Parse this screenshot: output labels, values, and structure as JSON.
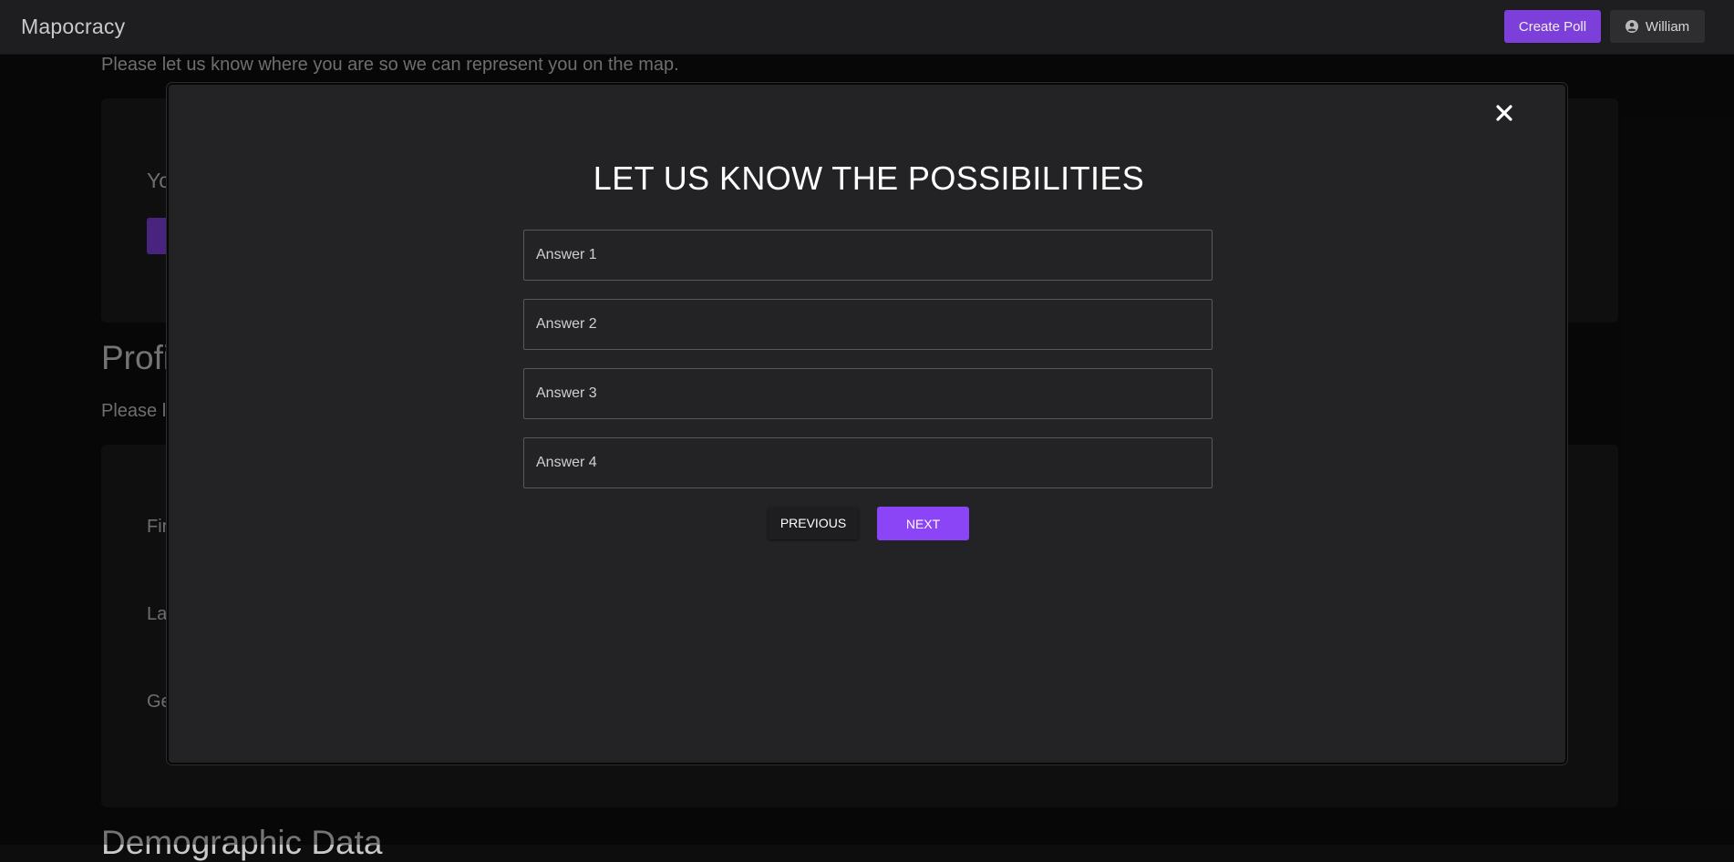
{
  "navbar": {
    "brand": "Mapocracy",
    "create_poll_label": "Create Poll",
    "user_label": "William"
  },
  "background": {
    "location_intro": "Please let us know where you are so we can represent you on the map.",
    "location_card_text": "Yo",
    "profile_heading": "Profi",
    "profile_intro": "Please l",
    "field_first": "Fir",
    "field_last": "La",
    "field_gender": "Ge",
    "demographic_heading": "Demographic Data"
  },
  "modal": {
    "title": "LET US KNOW THE POSSIBILITIES",
    "answers": [
      {
        "placeholder": "Answer 1",
        "value": ""
      },
      {
        "placeholder": "Answer 2",
        "value": ""
      },
      {
        "placeholder": "Answer 3",
        "value": ""
      },
      {
        "placeholder": "Answer 4",
        "value": ""
      }
    ],
    "previous_label": "PREVIOUS",
    "next_label": "NEXT"
  },
  "colors": {
    "accent": "#8c44f7",
    "navbar_accent": "#7c3fd9",
    "modal_bg": "#232326"
  },
  "icons": {
    "close": "close-icon",
    "user": "user-circle-icon"
  }
}
